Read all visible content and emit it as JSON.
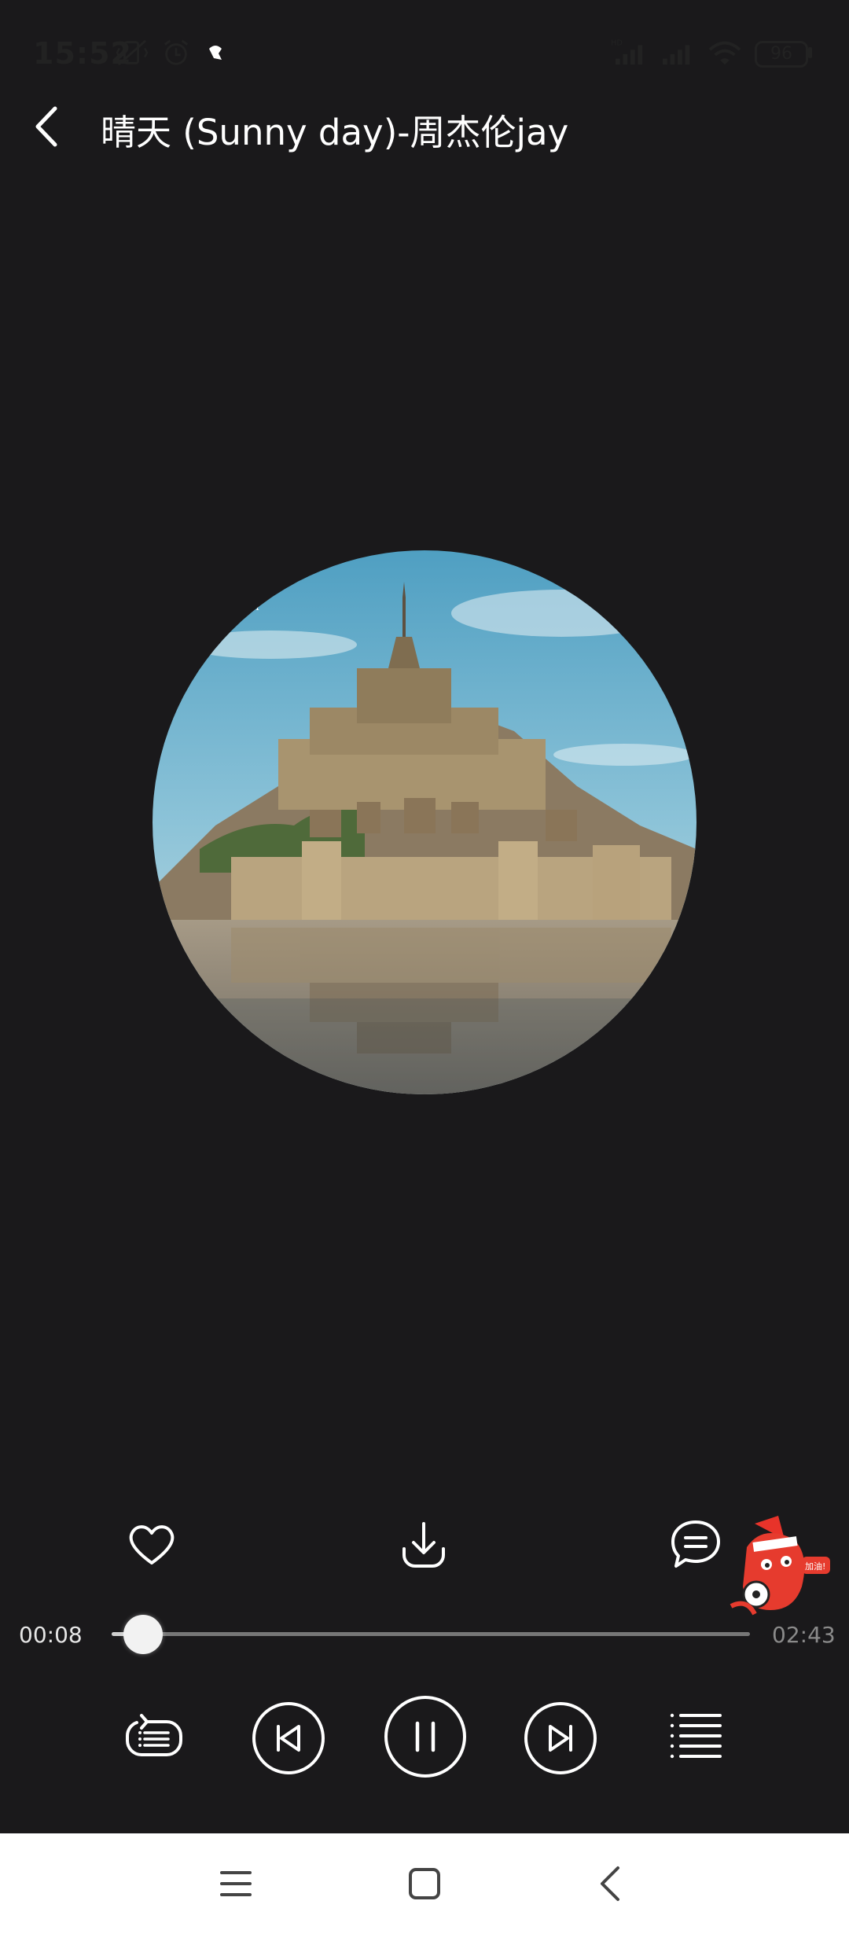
{
  "status_bar": {
    "time": "15:52",
    "battery": "96",
    "icons": [
      "mute-vibrate-icon",
      "alarm-icon",
      "app-notification-icon",
      "hd-signal-icon",
      "signal-icon",
      "wifi-icon",
      "battery-icon"
    ]
  },
  "header": {
    "back_icon": "chevron-left-icon",
    "title": "晴天 (Sunny day)-周杰伦jay"
  },
  "album_art": {
    "description_icon": "album-cover"
  },
  "actions": {
    "like_icon": "heart-icon",
    "download_icon": "download-icon",
    "comment_icon": "comment-icon"
  },
  "progress": {
    "current": "00:08",
    "total": "02:43",
    "fraction": 0.049
  },
  "controls": {
    "mode_icon": "playlist-loop-icon",
    "prev_icon": "previous-icon",
    "play_pause_icon": "pause-icon",
    "next_icon": "next-icon",
    "queue_icon": "queue-list-icon"
  },
  "nav": {
    "menu_icon": "menu-icon",
    "home_icon": "home-icon",
    "back_icon": "back-icon"
  },
  "colors": {
    "background": "#1a191b",
    "nav_background": "#ffffff"
  }
}
